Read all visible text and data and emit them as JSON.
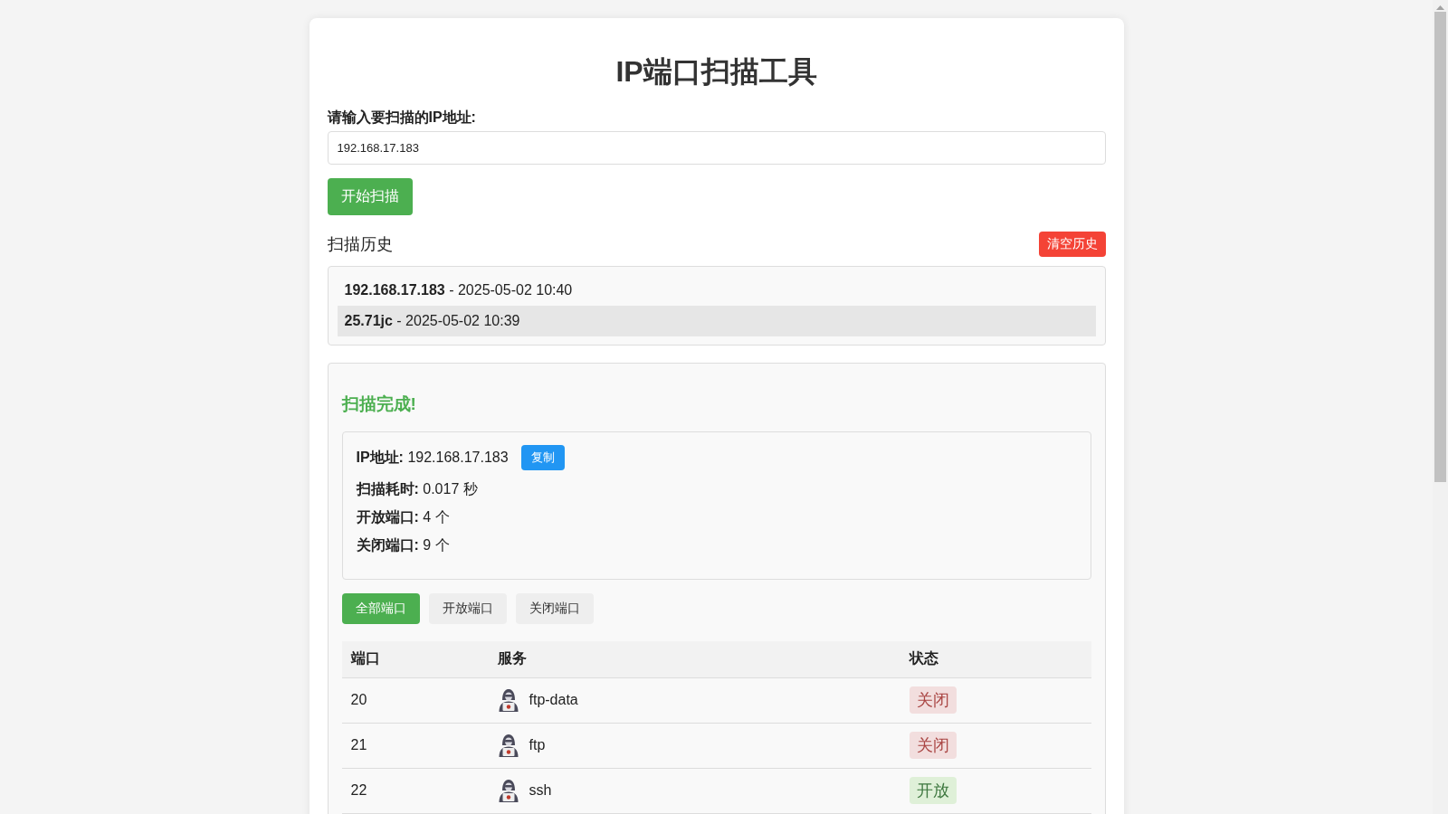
{
  "title": "IP端口扫描工具",
  "scan_form": {
    "label": "请输入要扫描的IP地址:",
    "ip_input": {
      "value": "192.168.17.183"
    },
    "scan_button": "开始扫描"
  },
  "history": {
    "title": "扫描历史",
    "clear_button": "清空历史",
    "items": [
      {
        "text": "**192.168.17.183** - 2025-05-02 10:40",
        "selected": false
      },
      {
        "text": "**25.71jc** - 2025-05-02 10:39",
        "selected": true
      }
    ]
  },
  "result": {
    "status": "扫描完成!",
    "summary": [
      {
        "text": "**IP地址:** 192.168.17.183",
        "copy_button": "复制"
      },
      {
        "text": "**扫描耗时:** 0.017 秒"
      },
      {
        "text": "**开放端口:** 4 个"
      },
      {
        "text": "**关闭端口:** 9 个"
      }
    ],
    "filters": [
      {
        "label": "全部端口",
        "selected": true
      },
      {
        "label": "开放端口",
        "selected": false
      },
      {
        "label": "关闭端口",
        "selected": false
      }
    ],
    "table": {
      "columns": [
        "端口",
        "服务",
        "状态"
      ],
      "rows": [
        {
          "port": "20",
          "service": "ftp-data",
          "status": "关闭",
          "open": false
        },
        {
          "port": "21",
          "service": "ftp",
          "status": "关闭",
          "open": false
        },
        {
          "port": "22",
          "service": "ssh",
          "status": "开放",
          "open": true
        }
      ]
    }
  }
}
